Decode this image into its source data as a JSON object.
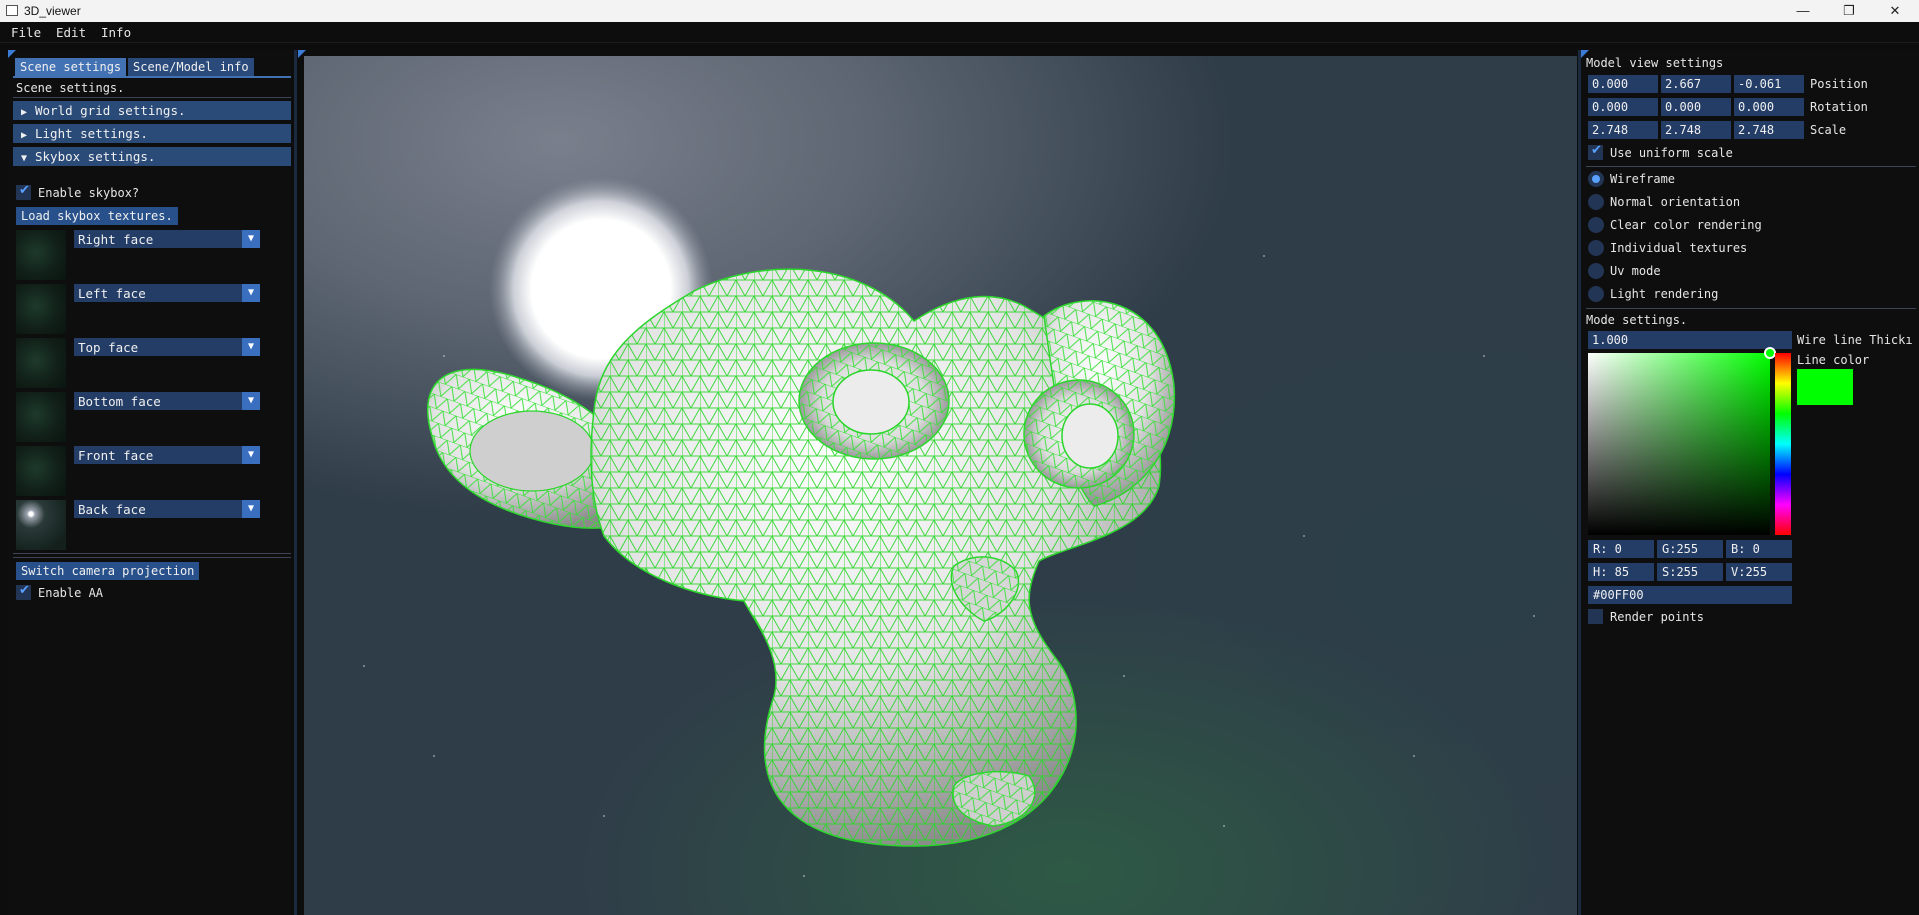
{
  "window": {
    "title": "3D_viewer",
    "minimize": "—",
    "maximize": "❐",
    "close": "✕"
  },
  "menu": [
    "File",
    "Edit",
    "Info"
  ],
  "left": {
    "tabs": [
      "Scene settings",
      "Scene/Model info"
    ],
    "heading": "Scene settings.",
    "sections": [
      "World grid settings.",
      "Light settings.",
      "Skybox settings."
    ],
    "enable_skybox": "Enable skybox?",
    "load_skybox": "Load skybox textures.",
    "faces": [
      "Right face",
      "Left face",
      "Top face",
      "Bottom face",
      "Front face",
      "Back face"
    ],
    "switch_projection": "Switch camera projection",
    "enable_aa": "Enable AA"
  },
  "right": {
    "title": "Model view settings",
    "position": {
      "label": "Position",
      "values": [
        "0.000",
        "2.667",
        "-0.061"
      ]
    },
    "rotation": {
      "label": "Rotation",
      "values": [
        "0.000",
        "0.000",
        "0.000"
      ]
    },
    "scale": {
      "label": "Scale",
      "values": [
        "2.748",
        "2.748",
        "2.748"
      ]
    },
    "uniform_scale": "Use uniform scale",
    "modes": [
      "Wireframe",
      "Normal orientation",
      "Clear color rendering",
      "Individual textures",
      "Uv mode",
      "Light rendering"
    ],
    "selected_mode": "Wireframe",
    "mode_settings": "Mode settings.",
    "thickness": {
      "value": "1.000",
      "label": "Wire line Thickı"
    },
    "line_color_label": "Line color",
    "rgb": [
      "R:  0",
      "G:255",
      "B:  0"
    ],
    "hsv": [
      "H: 85",
      "S:255",
      "V:255"
    ],
    "hex": "#00FF00",
    "render_points": "Render points"
  },
  "colors": {
    "accent": "#4272b4",
    "wire": "#00ff00",
    "panel": "#0e0e0e",
    "header": "#2a4a78"
  }
}
